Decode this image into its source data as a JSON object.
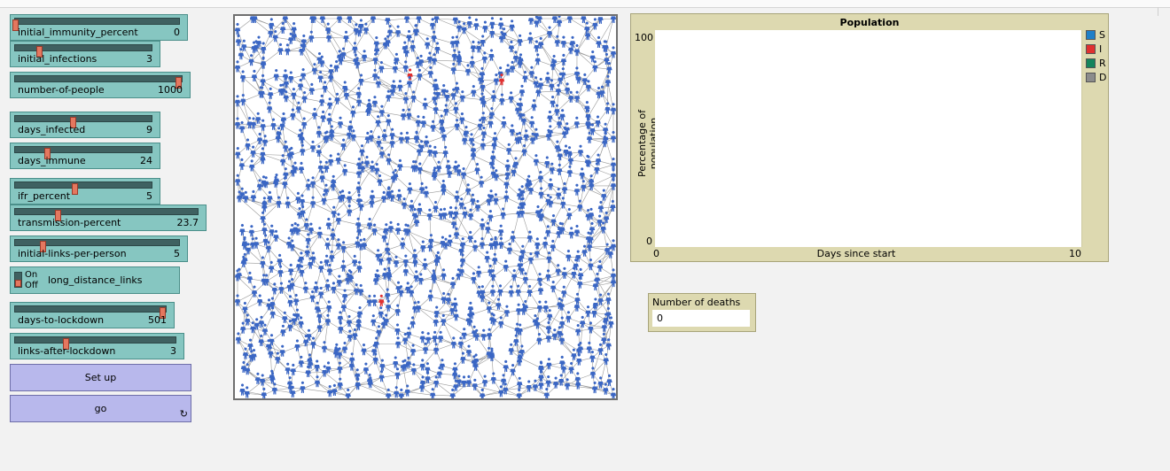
{
  "sliders": [
    {
      "id": "initial-immunity-percent",
      "label": "initial_immunity_percent",
      "value": "0",
      "fraction": 0.0
    },
    {
      "id": "initial-infections",
      "label": "initial_infections",
      "value": "3",
      "fraction": 0.18
    },
    {
      "id": "number-of-people",
      "label": "number-of-people",
      "value": "1000",
      "fraction": 1.0
    },
    {
      "id": "days-infected",
      "label": "days_infected",
      "value": "9",
      "fraction": 0.43
    },
    {
      "id": "days-immune",
      "label": "days_immune",
      "value": "24",
      "fraction": 0.24
    },
    {
      "id": "ifr-percent",
      "label": "ifr_percent",
      "value": "5",
      "fraction": 0.45
    },
    {
      "id": "transmission-percent",
      "label": "transmission-percent",
      "value": "23.7",
      "fraction": 0.24
    },
    {
      "id": "initial-links-per-person",
      "label": "initial-links-per-person",
      "value": "5",
      "fraction": 0.17
    },
    {
      "id": "days-to-lockdown",
      "label": "days-to-lockdown",
      "value": "501",
      "fraction": 1.0
    },
    {
      "id": "links-after-lockdown",
      "label": "links-after-lockdown",
      "value": "3",
      "fraction": 0.32
    }
  ],
  "switch": {
    "on_label": "On",
    "off_label": "Off",
    "label": "long_distance_links",
    "state": "off"
  },
  "buttons": {
    "setup_label": "Set up",
    "go_label": "go",
    "forever_glyph": "↻"
  },
  "plot": {
    "title": "Population",
    "ylabel": "Percentage of population",
    "xlabel": "Days since start",
    "ymin": "0",
    "ymax": "100",
    "xmin": "0",
    "xmax": "10",
    "legend": [
      {
        "name": "S",
        "color": "#1f7fc8"
      },
      {
        "name": "I",
        "color": "#e03030"
      },
      {
        "name": "R",
        "color": "#14845c"
      },
      {
        "name": "D",
        "color": "#8c8c8c"
      }
    ]
  },
  "monitor": {
    "label": "Number of deaths",
    "value": "0"
  },
  "colors": {
    "susceptible": "#3a66c4",
    "infected": "#e03030",
    "link": "#9a9a9a"
  },
  "world": {
    "people_count": 1000,
    "infected_count": 3
  }
}
